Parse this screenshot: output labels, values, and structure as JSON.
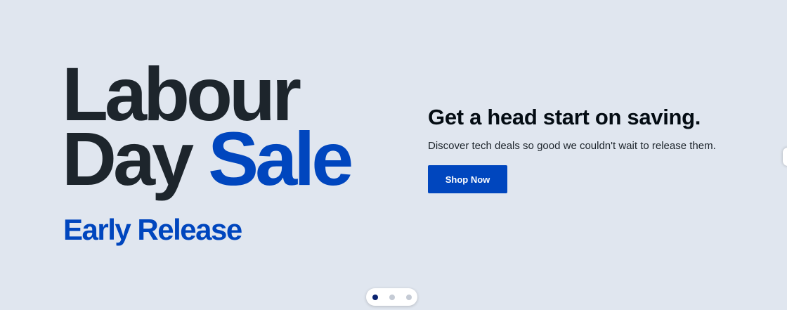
{
  "hero": {
    "headline_line1": "Labour",
    "headline_line2_word1": "Day",
    "headline_line2_word2": "Sale",
    "subhead": "Early Release",
    "promo_title": "Get a head start on saving.",
    "promo_text": "Discover tech deals so good we couldn't wait to release them.",
    "cta_label": "Shop Now"
  },
  "carousel": {
    "slide_count": 3,
    "active_index": 0
  },
  "colors": {
    "background": "#e0e6ef",
    "dark_text": "#1d252c",
    "brand_blue": "#0046be",
    "active_dot": "#0a2370",
    "inactive_dot": "#c5cbd5"
  }
}
